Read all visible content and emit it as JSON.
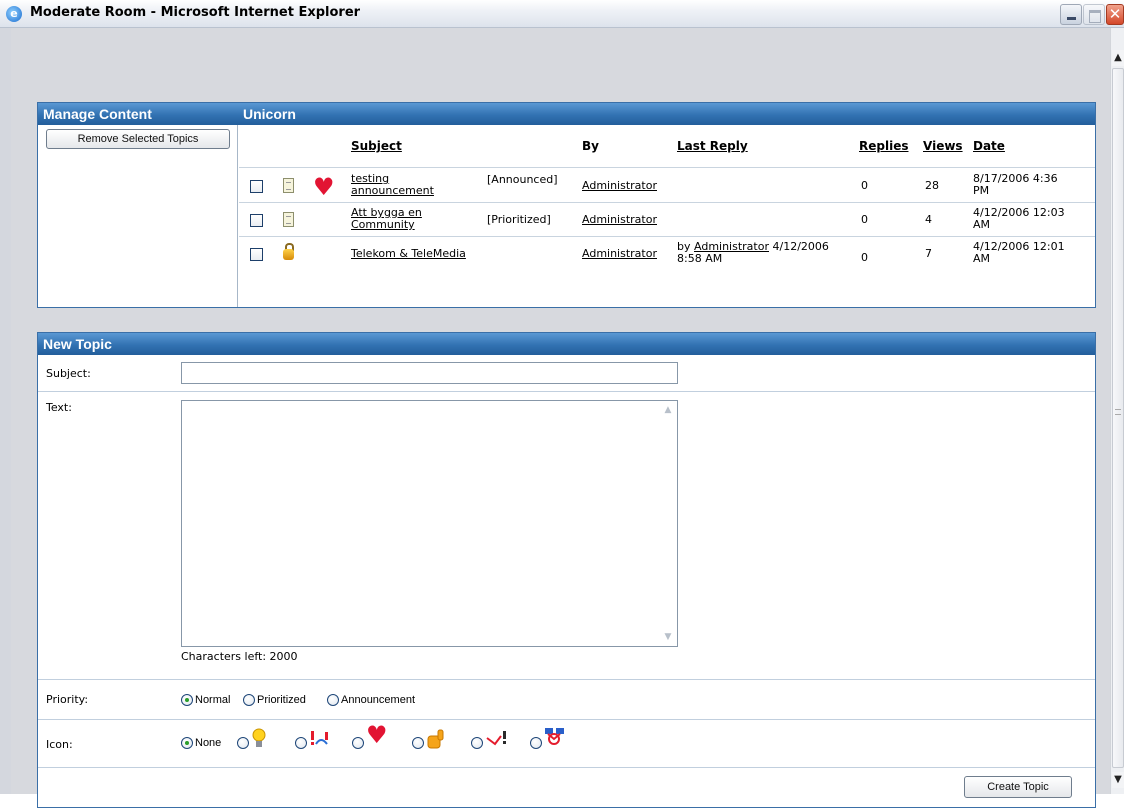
{
  "window": {
    "title": "Moderate Room - Microsoft Internet Explorer",
    "ie_icon": "ie-logo-icon",
    "controls": [
      "minimize",
      "maximize",
      "close"
    ]
  },
  "manage": {
    "heading": "Manage Content",
    "room": "Unicorn",
    "remove_button": "Remove Selected Topics",
    "columns": {
      "subject": "Subject",
      "by": "By",
      "last_reply": "Last Reply",
      "replies": "Replies",
      "views": "Views",
      "date": "Date"
    },
    "topics": [
      {
        "type_icon": "document-icon",
        "mood_icon": "heart-icon",
        "subject_line1": "testing",
        "subject_line2": "announcement",
        "status": "[Announced]",
        "by": "Administrator",
        "last_reply_prefix": "",
        "last_reply_user": "",
        "last_reply_date": "",
        "last_reply_time": "",
        "replies": "0",
        "views": "28",
        "date_line1": "8/17/2006 4:36",
        "date_line2": "PM"
      },
      {
        "type_icon": "document-icon",
        "mood_icon": "",
        "subject_line1": "Att bygga en",
        "subject_line2": "Community",
        "status": "[Prioritized]",
        "by": "Administrator",
        "last_reply_prefix": "",
        "last_reply_user": "",
        "last_reply_date": "",
        "last_reply_time": "",
        "replies": "0",
        "views": "4",
        "date_line1": "4/12/2006 12:03",
        "date_line2": "AM"
      },
      {
        "type_icon": "lock-icon",
        "mood_icon": "",
        "subject_line1": "Telekom & TeleMedia",
        "subject_line2": "",
        "status": "",
        "by": "Administrator",
        "last_reply_prefix": "by",
        "last_reply_user": "Administrator",
        "last_reply_date": "4/12/2006",
        "last_reply_time": "8:58 AM",
        "replies": "0",
        "views": "7",
        "date_line1": "4/12/2006 12:01",
        "date_line2": "AM"
      }
    ]
  },
  "new_topic": {
    "heading": "New Topic",
    "subject_label": "Subject:",
    "subject_value": "",
    "text_label": "Text:",
    "text_value": "",
    "chars_left": "Characters left: 2000",
    "priority_label": "Priority:",
    "priority_options": [
      "Normal",
      "Prioritized",
      "Announcement"
    ],
    "priority_selected": "Normal",
    "icon_label": "Icon:",
    "icon_options": [
      "None",
      "lightbulb-icon",
      "exclamation-icon",
      "heart-icon",
      "thumbs-up-icon",
      "question-icon",
      "handshake-icon"
    ],
    "icon_selected": "None",
    "create_button": "Create Topic"
  }
}
